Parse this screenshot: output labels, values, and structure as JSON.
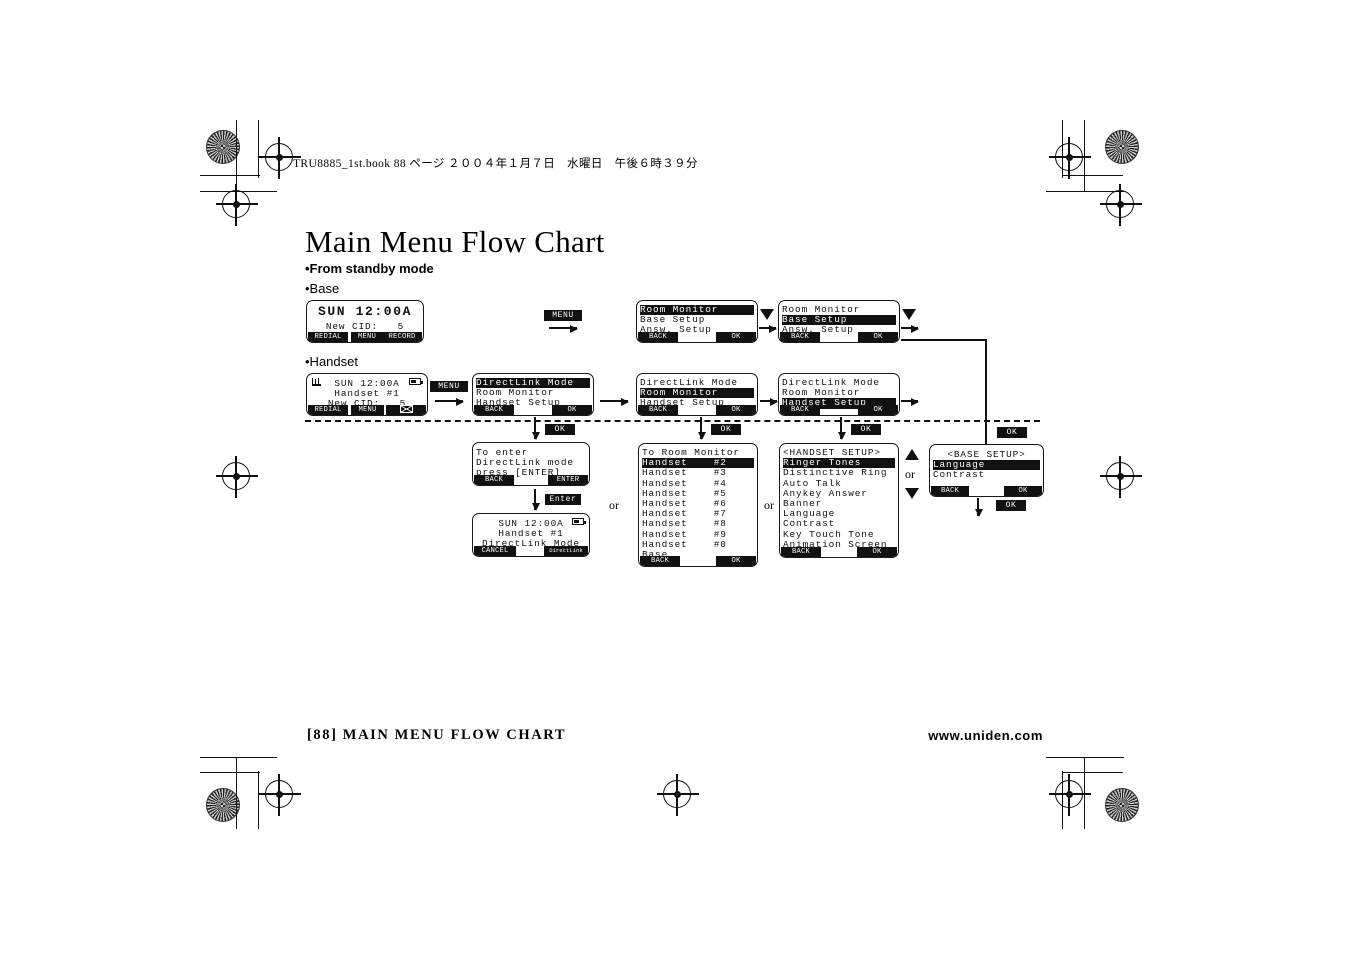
{
  "book_info": "TRU8885_1st.book  88 ページ  ２００４年１月７日　水曜日　午後６時３９分",
  "page_title": "Main Menu Flow Chart",
  "bullets": {
    "standby": "•From standby mode",
    "base": "•Base",
    "handset": "•Handset"
  },
  "footer": {
    "left": "[88] MAIN MENU FLOW CHART",
    "right": "www.uniden.com"
  },
  "keys": {
    "menu": "MENU",
    "ok": "OK",
    "enter": "Enter",
    "or": "or"
  },
  "screens": {
    "base_standby": {
      "line1": "SUN 12:00A",
      "line2": "New CID:   5",
      "soft_left": "REDIAL",
      "soft_mid": "MENU",
      "soft_right": "RECORD"
    },
    "base_menu_1": {
      "items": [
        "Room Monitor",
        "Base Setup",
        "Answ. Setup"
      ],
      "selected": 0,
      "soft_left": "BACK",
      "soft_right": "OK"
    },
    "base_menu_2": {
      "items": [
        "Room Monitor",
        "Base Setup",
        "Answ. Setup"
      ],
      "selected": 1,
      "soft_left": "BACK",
      "soft_right": "OK"
    },
    "handset_standby": {
      "line1": "SUN 12:00A",
      "line2": "Handset #1",
      "line3": "New CID:   5",
      "soft_left": "REDIAL",
      "soft_mid": "MENU",
      "soft_right": "envelope-icon"
    },
    "handset_menu_1": {
      "items": [
        "DirectLink Mode",
        "Room Monitor",
        "Handset Setup"
      ],
      "selected": 0,
      "soft_left": "BACK",
      "soft_right": "OK"
    },
    "handset_menu_2": {
      "items": [
        "DirectLink Mode",
        "Room Monitor",
        "Handset Setup"
      ],
      "selected": 1,
      "soft_left": "BACK",
      "soft_right": "OK"
    },
    "handset_menu_3": {
      "items": [
        "DirectLink Mode",
        "Room Monitor",
        "Handset Setup"
      ],
      "selected": 2,
      "soft_left": "BACK",
      "soft_right": "OK"
    },
    "directlink_prompt": {
      "line1": "To enter",
      "line2": "DirectLink mode",
      "line3": "press [ENTER]",
      "soft_left": "BACK",
      "soft_right": "ENTER"
    },
    "directlink_active": {
      "line1": "SUN 12:00A",
      "line2": "Handset #1",
      "line3": "DirectLink Mode",
      "soft_left": "CANCEL",
      "soft_right": "DirectLink"
    },
    "room_monitor": {
      "title": "To Room Monitor",
      "items": [
        "Handset    #2",
        "Handset    #3",
        "Handset    #4",
        "Handset    #5",
        "Handset    #6",
        "Handset    #7",
        "Handset    #8",
        "Handset    #9",
        "Handset    #0",
        "Base"
      ],
      "selected": 0,
      "soft_left": "BACK",
      "soft_right": "OK"
    },
    "handset_setup": {
      "title": "<HANDSET SETUP>",
      "items": [
        "Ringer Tones",
        "Distinctive Ring",
        "Auto Talk",
        "Anykey Answer",
        "Banner",
        "Language",
        "Contrast",
        "Key Touch Tone",
        "Animation Screen"
      ],
      "selected": 0,
      "soft_left": "BACK",
      "soft_right": "OK"
    },
    "base_setup": {
      "title": "<BASE SETUP>",
      "items": [
        "Language",
        "Contrast"
      ],
      "selected": 0,
      "soft_left": "BACK",
      "soft_right": "OK"
    }
  }
}
